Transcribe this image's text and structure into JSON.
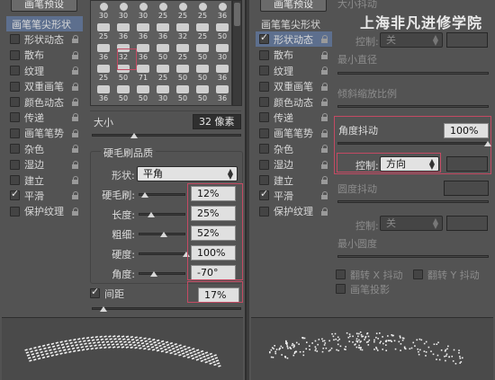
{
  "left": {
    "presets_button": "画笔预设",
    "sidebar": [
      {
        "label": "画笔笔尖形状",
        "checkbox": false,
        "checked": false,
        "lock": false,
        "selected": true
      },
      {
        "label": "形状动态",
        "checkbox": true,
        "checked": false,
        "lock": true
      },
      {
        "label": "散布",
        "checkbox": true,
        "checked": false,
        "lock": true
      },
      {
        "label": "纹理",
        "checkbox": true,
        "checked": false,
        "lock": true
      },
      {
        "label": "双重画笔",
        "checkbox": true,
        "checked": false,
        "lock": true
      },
      {
        "label": "颜色动态",
        "checkbox": true,
        "checked": false,
        "lock": true
      },
      {
        "label": "传递",
        "checkbox": true,
        "checked": false,
        "lock": true
      },
      {
        "label": "画笔笔势",
        "checkbox": true,
        "checked": false,
        "lock": true
      },
      {
        "label": "杂色",
        "checkbox": true,
        "checked": false,
        "lock": true
      },
      {
        "label": "湿边",
        "checkbox": true,
        "checked": false,
        "lock": true
      },
      {
        "label": "建立",
        "checkbox": true,
        "checked": false,
        "lock": true
      },
      {
        "label": "平滑",
        "checkbox": true,
        "checked": true,
        "lock": true
      },
      {
        "label": "保护纹理",
        "checkbox": true,
        "checked": false,
        "lock": true
      }
    ],
    "brush_rows": [
      [
        "30",
        "30",
        "30",
        "25",
        "25",
        "25",
        "36"
      ],
      [
        "25",
        "36",
        "36",
        "36",
        "32",
        "25",
        "50"
      ],
      [
        "36",
        "32",
        "36",
        "50",
        "25",
        "50",
        "30"
      ],
      [
        "25",
        "50",
        "71",
        "25",
        "50",
        "50",
        "36"
      ],
      [
        "36",
        "50",
        "50",
        "30",
        "50",
        "50",
        "36"
      ]
    ],
    "size_label": "大小",
    "size_value": "32 像素",
    "bristle_title": "硬毛刷品质",
    "shape_label": "形状:",
    "shape_value": "平角",
    "params": [
      {
        "label": "硬毛刷:",
        "value": "12%",
        "level": 0.12
      },
      {
        "label": "长度:",
        "value": "25%",
        "level": 0.25
      },
      {
        "label": "粗细:",
        "value": "52%",
        "level": 0.52
      },
      {
        "label": "硬度:",
        "value": "100%",
        "level": 1.0
      },
      {
        "label": "角度:",
        "value": "-70°",
        "level": 0.31
      }
    ],
    "spacing_label": "间距",
    "spacing_value": "17%",
    "spacing_checked": true
  },
  "right": {
    "presets_button": "画笔预设",
    "watermark": "上海非凡进修学院",
    "sidebar": [
      {
        "label": "画笔笔尖形状",
        "checkbox": false,
        "checked": false,
        "lock": false
      },
      {
        "label": "形状动态",
        "checkbox": true,
        "checked": true,
        "lock": true,
        "selected": true
      },
      {
        "label": "散布",
        "checkbox": true,
        "checked": false,
        "lock": true
      },
      {
        "label": "纹理",
        "checkbox": true,
        "checked": false,
        "lock": true
      },
      {
        "label": "双重画笔",
        "checkbox": true,
        "checked": false,
        "lock": true
      },
      {
        "label": "颜色动态",
        "checkbox": true,
        "checked": false,
        "lock": true
      },
      {
        "label": "传递",
        "checkbox": true,
        "checked": false,
        "lock": true
      },
      {
        "label": "画笔笔势",
        "checkbox": true,
        "checked": false,
        "lock": true
      },
      {
        "label": "杂色",
        "checkbox": true,
        "checked": false,
        "lock": true
      },
      {
        "label": "湿边",
        "checkbox": true,
        "checked": false,
        "lock": true
      },
      {
        "label": "建立",
        "checkbox": true,
        "checked": false,
        "lock": true
      },
      {
        "label": "平滑",
        "checkbox": true,
        "checked": true,
        "lock": true
      },
      {
        "label": "保护纹理",
        "checkbox": true,
        "checked": false,
        "lock": true
      }
    ],
    "size_jitter_label": "大小抖动",
    "control1_label": "控制:",
    "control1_value": "关",
    "min_diameter_label": "最小直径",
    "tilt_scale_label": "倾斜缩放比例",
    "angle_jitter_label": "角度抖动",
    "angle_jitter_value": "100%",
    "angle_jitter_level": 1.0,
    "control2_label": "控制:",
    "control2_value": "方向",
    "roundness_jitter_label": "圆度抖动",
    "control3_label": "控制:",
    "control3_value": "关",
    "min_roundness_label": "最小圆度",
    "flip_x_label": "翻转 X 抖动",
    "flip_y_label": "翻转 Y 抖动",
    "brush_projection_label": "画笔投影"
  }
}
